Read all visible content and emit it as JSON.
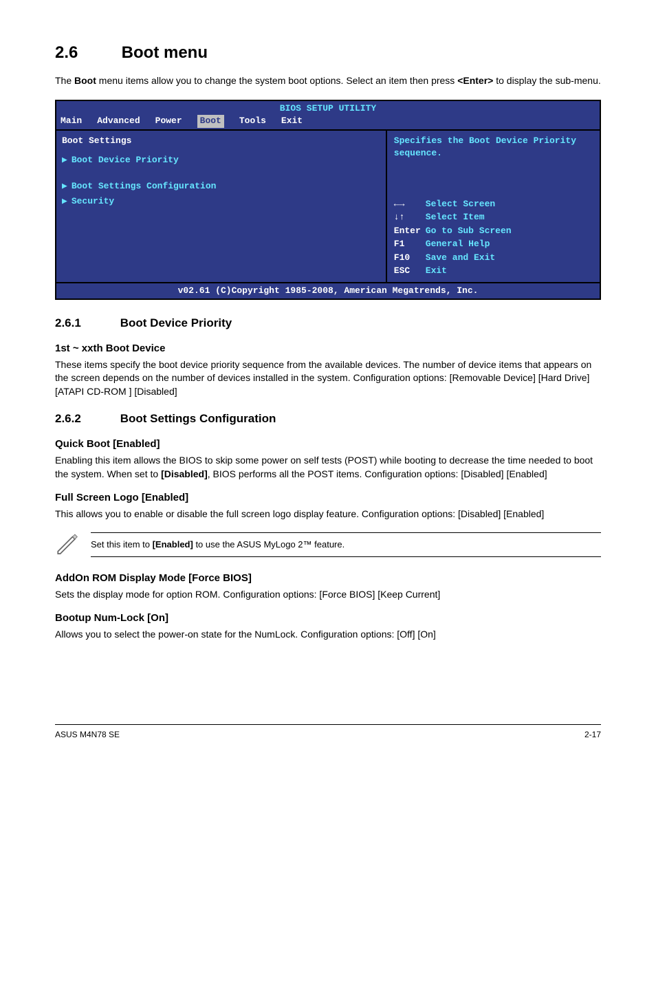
{
  "section": {
    "number": "2.6",
    "title": "Boot menu"
  },
  "intro": {
    "line1_pre": "The ",
    "line1_bold": "Boot",
    "line1_post": " menu items allow you to change the system boot options. Select an item then press ",
    "line2_bold": "<Enter>",
    "line2_post": " to display the sub-menu."
  },
  "bios": {
    "title": "BIOS SETUP UTILITY",
    "tabs": [
      "Main",
      "Advanced",
      "Power",
      "Boot",
      "Tools",
      "Exit"
    ],
    "active_tab_index": 3,
    "left": {
      "heading": "Boot Settings",
      "items": [
        {
          "label": "Boot Device Priority",
          "selected": true
        },
        {
          "label": "Boot Settings Configuration",
          "selected": false
        },
        {
          "label": "Security",
          "selected": false
        }
      ]
    },
    "help": {
      "top": "Specifies the Boot Device Priority sequence.",
      "keys": [
        {
          "key": "←→",
          "action": "Select Screen"
        },
        {
          "key": "↓↑",
          "action": "Select Item"
        },
        {
          "key": "Enter",
          "action": "Go to Sub Screen"
        },
        {
          "key": "F1",
          "action": "General Help"
        },
        {
          "key": "F10",
          "action": "Save and Exit"
        },
        {
          "key": "ESC",
          "action": "Exit"
        }
      ]
    },
    "footer": "v02.61 (C)Copyright 1985-2008, American Megatrends, Inc."
  },
  "s261": {
    "num": "2.6.1",
    "title": "Boot Device Priority",
    "h": "1st ~ xxth Boot Device",
    "p": "These items specify the boot device priority sequence from the available devices. The number of device items that appears on the screen depends on the number of devices installed in the system. Configuration options: [Removable Device] [Hard Drive] [ATAPI CD-ROM ] [Disabled]"
  },
  "s262": {
    "num": "2.6.2",
    "title": "Boot Settings Configuration",
    "quick": {
      "h": "Quick Boot [Enabled]",
      "p_pre": "Enabling this item allows the BIOS to skip some power on self tests (POST) while booting to decrease the time needed to boot the system. When set to ",
      "p_bold": "[Disabled]",
      "p_post": ", BIOS performs all the POST items. Configuration options: [Disabled] [Enabled]"
    },
    "logo": {
      "h": "Full Screen Logo [Enabled]",
      "p": "This allows you to enable or disable the full screen logo display feature. Configuration options: [Disabled] [Enabled]"
    },
    "note": {
      "pre": "Set this item to ",
      "bold": "[Enabled]",
      "post": " to use the ASUS MyLogo 2™ feature."
    },
    "addon": {
      "h": "AddOn ROM Display Mode [Force BIOS]",
      "p": "Sets the display mode for option ROM. Configuration options: [Force BIOS] [Keep Current]"
    },
    "numlock": {
      "h": "Bootup Num-Lock [On]",
      "p": "Allows you to select the power-on state for the NumLock. Configuration options: [Off] [On]"
    }
  },
  "footer": {
    "left": "ASUS M4N78 SE",
    "right": "2-17"
  }
}
